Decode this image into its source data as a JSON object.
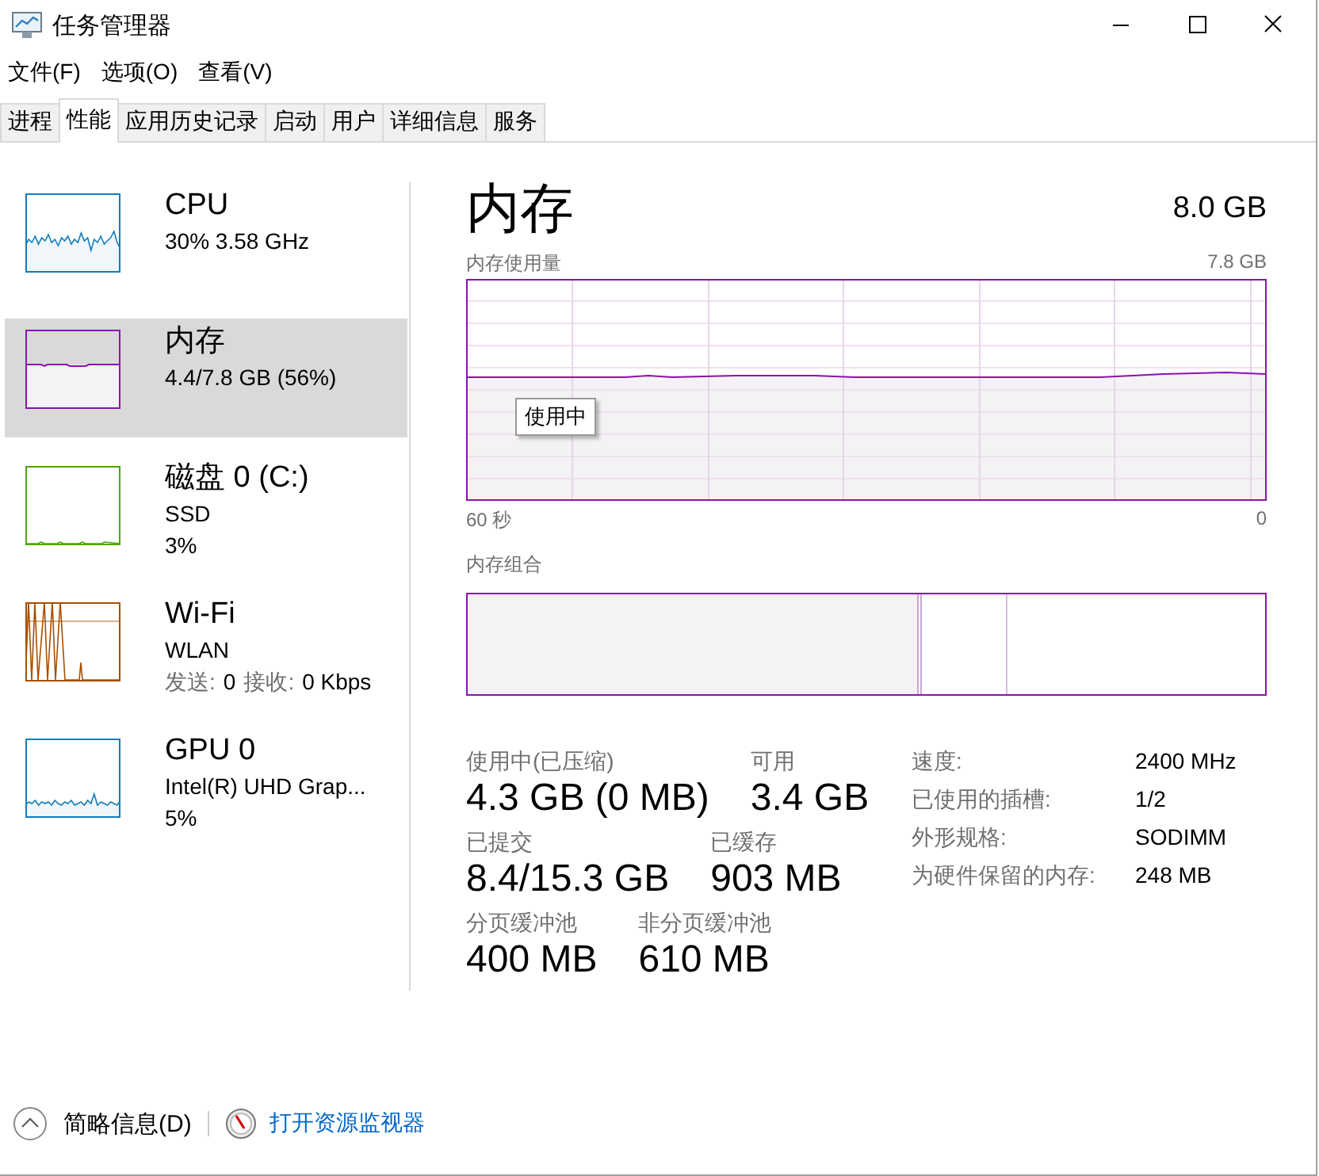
{
  "window": {
    "title": "任务管理器"
  },
  "menu": [
    "文件(F)",
    "选项(O)",
    "查看(V)"
  ],
  "tabs": [
    {
      "label": "进程",
      "selected": false
    },
    {
      "label": "性能",
      "selected": true
    },
    {
      "label": "应用历史记录",
      "selected": false
    },
    {
      "label": "启动",
      "selected": false
    },
    {
      "label": "用户",
      "selected": false
    },
    {
      "label": "详细信息",
      "selected": false
    },
    {
      "label": "服务",
      "selected": false
    }
  ],
  "sidebar": {
    "items": [
      {
        "kind": "cpu",
        "name": "CPU",
        "color": "#117dbb",
        "selected": false,
        "lines": [
          {
            "kind": "text",
            "text": "30% 3.58 GHz"
          }
        ]
      },
      {
        "kind": "memory",
        "name": "内存",
        "color": "#8b12ae",
        "selected": true,
        "lines": [
          {
            "kind": "text",
            "text": "4.4/7.8 GB (56%)"
          }
        ]
      },
      {
        "kind": "disk",
        "name": "磁盘 0 (C:)",
        "color": "#4da60c",
        "selected": false,
        "lines": [
          {
            "kind": "text",
            "text": "SSD"
          },
          {
            "kind": "text",
            "text": "3%"
          }
        ]
      },
      {
        "kind": "network",
        "name": "Wi-Fi",
        "color": "#a74f01",
        "selected": false,
        "lines": [
          {
            "kind": "text",
            "text": "WLAN"
          },
          {
            "kind": "rate",
            "send_label": "发送:",
            "send_value": "0",
            "recv_label": "接收:",
            "recv_value": "0 Kbps"
          }
        ]
      },
      {
        "kind": "gpu",
        "name": "GPU 0",
        "color": "#117dbb",
        "selected": false,
        "lines": [
          {
            "kind": "text",
            "text": "Intel(R) UHD Grap..."
          },
          {
            "kind": "text",
            "text": "5%"
          }
        ]
      }
    ]
  },
  "main": {
    "title": "内存",
    "capacity": "8.0 GB",
    "usage_graph": {
      "label": "内存使用量",
      "max": "7.8 GB",
      "time_start": "60 秒",
      "time_end": "0",
      "tooltip": "使用中"
    },
    "composition": {
      "label": "内存组合"
    },
    "stats": [
      [
        {
          "label": "使用中(已压缩)",
          "value": "4.3 GB (0 MB)"
        },
        {
          "label": "可用",
          "value": "3.4 GB"
        }
      ],
      [
        {
          "label": "已提交",
          "value": "8.4/15.3 GB"
        },
        {
          "label": "已缓存",
          "value": "903 MB"
        }
      ],
      [
        {
          "label": "分页缓冲池",
          "value": "400 MB"
        },
        {
          "label": "非分页缓冲池",
          "value": "610 MB"
        }
      ]
    ],
    "properties": [
      {
        "label": "速度:",
        "value": "2400 MHz"
      },
      {
        "label": "已使用的插槽:",
        "value": "1/2"
      },
      {
        "label": "外形规格:",
        "value": "SODIMM"
      },
      {
        "label": "为硬件保留的内存:",
        "value": "248 MB"
      }
    ]
  },
  "footer": {
    "fewer_details": "简略信息(D)",
    "resource_monitor": "打开资源监视器"
  }
}
